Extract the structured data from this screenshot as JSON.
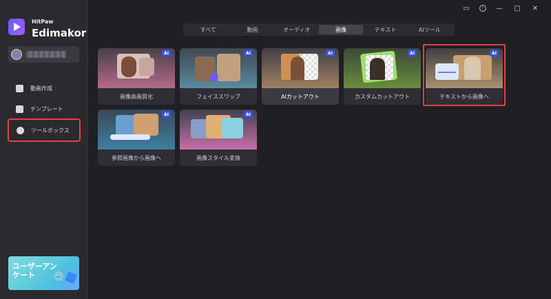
{
  "app": {
    "brand_small": "HitPaw",
    "brand_big": "Edimakor"
  },
  "sidebar": {
    "items": [
      {
        "label": "動画作成",
        "icon": "home-icon"
      },
      {
        "label": "テンプレート",
        "icon": "template-icon"
      },
      {
        "label": "ツールボックス",
        "icon": "toolbox-icon"
      }
    ],
    "survey": {
      "text": "ユーザーアンケート"
    }
  },
  "tabs": [
    "すべて",
    "動画",
    "オーディオ",
    "画像",
    "テキスト",
    "AIツール"
  ],
  "active_tab": "画像",
  "cards": [
    {
      "label": "画像高画質化",
      "ai": "AI"
    },
    {
      "label": "フェイススワップ",
      "ai": "AI"
    },
    {
      "label": "AIカットアウト",
      "ai": "AI"
    },
    {
      "label": "カスタムカットアウト",
      "ai": "AI"
    },
    {
      "label": "テキストから画像へ",
      "ai": "AI"
    },
    {
      "label": "参照画像から画像へ",
      "ai": "AI"
    },
    {
      "label": "画像スタイル変換",
      "ai": "AI"
    }
  ],
  "colors": {
    "accent_red": "#e0433a",
    "ai_badge": "#3a52d9"
  }
}
